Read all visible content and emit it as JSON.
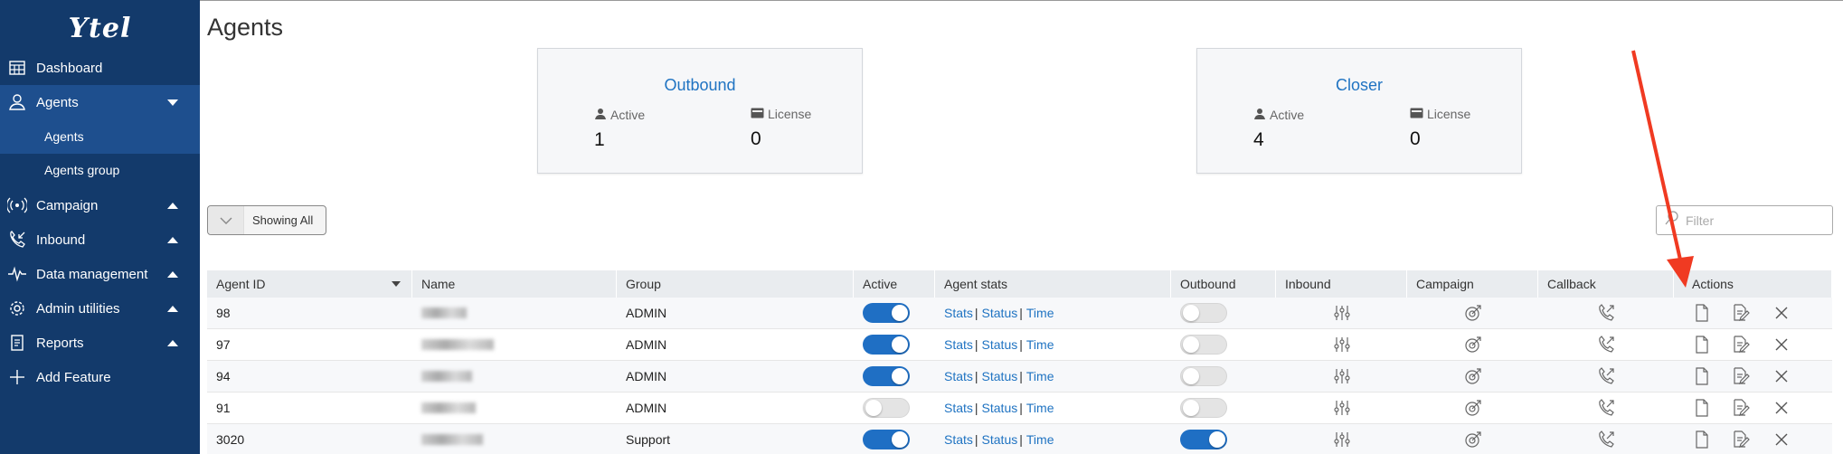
{
  "sidebar": {
    "logo": "Ytel",
    "items": [
      {
        "label": "Dashboard",
        "icon": "dashboard-icon"
      },
      {
        "label": "Agents",
        "icon": "agents-icon",
        "caret": "down"
      },
      {
        "label": "Agents",
        "sub": true
      },
      {
        "label": "Agents group",
        "sub": true
      },
      {
        "label": "Campaign",
        "icon": "campaign-icon",
        "caret": "up"
      },
      {
        "label": "Inbound",
        "icon": "inbound-icon",
        "caret": "up"
      },
      {
        "label": "Data management",
        "icon": "data-management-icon",
        "caret": "up"
      },
      {
        "label": "Admin utilities",
        "icon": "admin-utilities-icon",
        "caret": "up"
      },
      {
        "label": "Reports",
        "icon": "reports-icon",
        "caret": "up"
      },
      {
        "label": "Add Feature",
        "icon": "plus-icon"
      }
    ]
  },
  "page": {
    "title": "Agents"
  },
  "cards": [
    {
      "title": "Outbound",
      "active_label": "Active",
      "active_value": "1",
      "license_label": "License",
      "license_value": "0"
    },
    {
      "title": "Closer",
      "active_label": "Active",
      "active_value": "4",
      "license_label": "License",
      "license_value": "0"
    }
  ],
  "toolbar": {
    "showing_label": "Showing All",
    "filter_placeholder": "Filter"
  },
  "table": {
    "columns": [
      "Agent ID",
      "Name",
      "Group",
      "Active",
      "Agent stats",
      "Outbound",
      "Inbound",
      "Campaign",
      "Callback",
      "Actions"
    ],
    "stats_links": [
      "Stats",
      "Status",
      "Time"
    ],
    "rows": [
      {
        "id": "98",
        "group": "ADMIN",
        "active": true,
        "outbound": false
      },
      {
        "id": "97",
        "group": "ADMIN",
        "active": true,
        "outbound": false
      },
      {
        "id": "94",
        "group": "ADMIN",
        "active": true,
        "outbound": false
      },
      {
        "id": "91",
        "group": "ADMIN",
        "active": false,
        "outbound": false
      },
      {
        "id": "3020",
        "group": "Support",
        "active": true,
        "outbound": true
      }
    ]
  },
  "colors": {
    "sidebar": "#133a6b",
    "sidebar_active": "#1e4f8e",
    "link": "#1f73c2",
    "toggle_on": "#1f6fc4",
    "annotation_arrow": "#f03a22"
  }
}
